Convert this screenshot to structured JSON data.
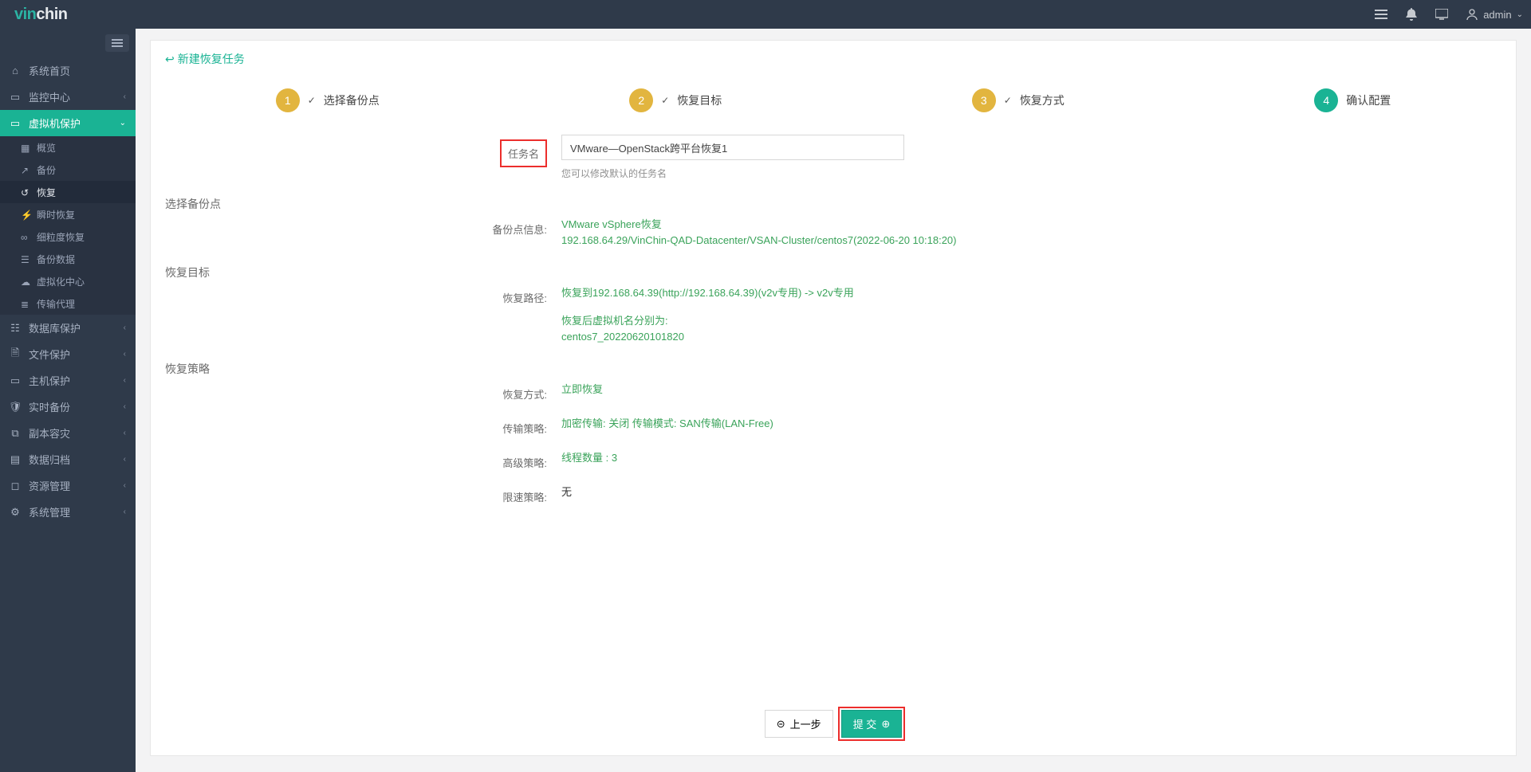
{
  "brand": {
    "a": "vin",
    "b": "chin"
  },
  "topbar": {
    "user_label": "admin"
  },
  "sidebar": {
    "items": [
      {
        "label": "系统首页",
        "icon": "home"
      },
      {
        "label": "监控中心",
        "icon": "monitor",
        "chev": true
      },
      {
        "label": "虚拟机保护",
        "icon": "vm",
        "chev": true,
        "active": true,
        "children": [
          {
            "label": "概览",
            "icon": "grid"
          },
          {
            "label": "备份",
            "icon": "share"
          },
          {
            "label": "恢复",
            "icon": "undo",
            "selected": true
          },
          {
            "label": "瞬时恢复",
            "icon": "bolt"
          },
          {
            "label": "细粒度恢复",
            "icon": "link"
          },
          {
            "label": "备份数据",
            "icon": "disk"
          },
          {
            "label": "虚拟化中心",
            "icon": "cloud"
          },
          {
            "label": "传输代理",
            "icon": "server"
          }
        ]
      },
      {
        "label": "数据库保护",
        "icon": "db",
        "chev": true
      },
      {
        "label": "文件保护",
        "icon": "file",
        "chev": true
      },
      {
        "label": "主机保护",
        "icon": "host",
        "chev": true
      },
      {
        "label": "实时备份",
        "icon": "shield",
        "chev": true
      },
      {
        "label": "副本容灾",
        "icon": "copy",
        "chev": true
      },
      {
        "label": "数据归档",
        "icon": "archive",
        "chev": true
      },
      {
        "label": "资源管理",
        "icon": "cube",
        "chev": true
      },
      {
        "label": "系统管理",
        "icon": "gear",
        "chev": true
      }
    ]
  },
  "panel": {
    "title": "新建恢复任务",
    "steps": [
      {
        "num": "1",
        "label": "选择备份点",
        "state": "done",
        "check": true
      },
      {
        "num": "2",
        "label": "恢复目标",
        "state": "done",
        "check": true
      },
      {
        "num": "3",
        "label": "恢复方式",
        "state": "done",
        "check": true
      },
      {
        "num": "4",
        "label": "确认配置",
        "state": "current",
        "check": false
      }
    ],
    "task_name_label": "任务名",
    "task_name_value": "VMware—OpenStack跨平台恢复1",
    "task_name_hint": "您可以修改默认的任务名",
    "sections": {
      "backup_point": {
        "heading": "选择备份点",
        "info_label": "备份点信息:",
        "info_line1": "VMware vSphere恢复",
        "info_line2": "192.168.64.29/VinChin-QAD-Datacenter/VSAN-Cluster/centos7(2022-06-20 10:18:20)"
      },
      "target": {
        "heading": "恢复目标",
        "path_label": "恢复路径:",
        "path_value": "恢复到192.168.64.39(http://192.168.64.39)(v2v专用) -> v2v专用",
        "vmname_label": "恢复后虚拟机名分别为:",
        "vmname_value": "centos7_20220620101820"
      },
      "policy": {
        "heading": "恢复策略",
        "mode_label": "恢复方式:",
        "mode_value": "立即恢复",
        "trans_label": "传输策略:",
        "trans_value": "加密传输: 关闭 传输模式: SAN传输(LAN-Free)",
        "adv_label": "高级策略:",
        "adv_value": "线程数量 : 3",
        "limit_label": "限速策略:",
        "limit_value": "无"
      }
    },
    "footer": {
      "prev": "上一步",
      "submit": "提 交"
    }
  }
}
